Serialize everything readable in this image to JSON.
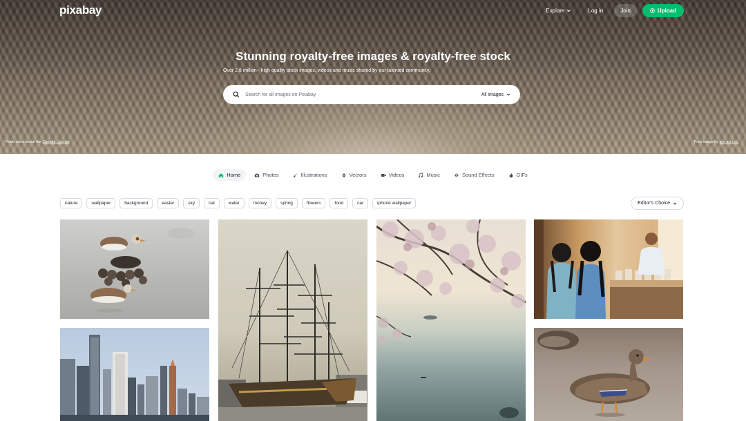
{
  "brand": {
    "logo": "pixabay",
    "accent": "#02be6e"
  },
  "topnav": {
    "explore": "Explore",
    "login": "Log in",
    "join": "Join",
    "upload": "Upload"
  },
  "hero": {
    "title": "Stunning royalty-free images & royalty-free stock",
    "subtitle": "Over 2.8 million+ high quality stock images, videos and music shared by our talented community.",
    "search_placeholder": "Search for all images on Pixabay",
    "search_filter": "All images",
    "license_prefix": "Read more about the",
    "license_link": "Content License",
    "credit_prefix": "Free image by",
    "credit_author": "amouton"
  },
  "tabs": [
    {
      "label": "Home",
      "icon": "home-icon",
      "active": true
    },
    {
      "label": "Photos",
      "icon": "camera-icon"
    },
    {
      "label": "Illustrations",
      "icon": "brush-icon"
    },
    {
      "label": "Vectors",
      "icon": "pen-icon"
    },
    {
      "label": "Videos",
      "icon": "video-icon"
    },
    {
      "label": "Music",
      "icon": "music-icon"
    },
    {
      "label": "Sound Effects",
      "icon": "sound-icon"
    },
    {
      "label": "GIFs",
      "icon": "gif-icon"
    }
  ],
  "chips": [
    "nature",
    "wallpaper",
    "background",
    "easter",
    "sky",
    "cat",
    "water",
    "money",
    "spring",
    "flowers",
    "food",
    "car",
    "iphone wallpaper"
  ],
  "sort": {
    "label": "Editor's Choice"
  }
}
